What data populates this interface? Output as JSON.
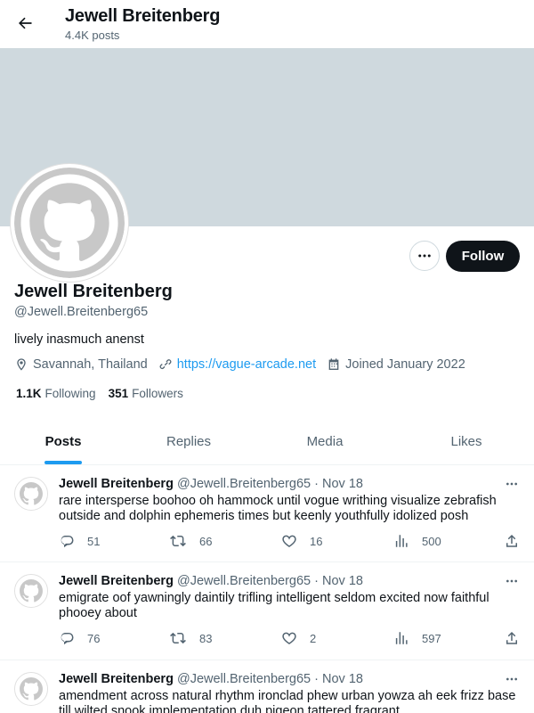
{
  "header": {
    "title": "Jewell Breitenberg",
    "posts_count": "4.4K posts"
  },
  "profile": {
    "name": "Jewell Breitenberg",
    "handle": "@Jewell.Breitenberg65",
    "bio": "lively inasmuch anenst",
    "location": "Savannah, Thailand",
    "website": "https://vague-arcade.net",
    "joined": "Joined January 2022",
    "following_count": "1.1K",
    "following_label": "Following",
    "followers_count": "351",
    "followers_label": "Followers",
    "follow_label": "Follow",
    "banner_color": "#cfd9de"
  },
  "tabs": [
    {
      "label": "Posts",
      "active": true
    },
    {
      "label": "Replies",
      "active": false
    },
    {
      "label": "Media",
      "active": false
    },
    {
      "label": "Likes",
      "active": false
    }
  ],
  "tweets": [
    {
      "name": "Jewell Breitenberg",
      "handle": "@Jewell.Breitenberg65",
      "separator": "·",
      "date": "Nov 18",
      "text": "rare intersperse boohoo oh hammock until vogue writhing visualize zebrafish outside and dolphin ephemeris times but keenly youthfully idolized posh",
      "replies": "51",
      "retweets": "66",
      "likes": "16",
      "views": "500"
    },
    {
      "name": "Jewell Breitenberg",
      "handle": "@Jewell.Breitenberg65",
      "separator": "·",
      "date": "Nov 18",
      "text": "emigrate oof yawningly daintily trifling intelligent seldom excited now faithful phooey about",
      "replies": "76",
      "retweets": "83",
      "likes": "2",
      "views": "597"
    },
    {
      "name": "Jewell Breitenberg",
      "handle": "@Jewell.Breitenberg65",
      "separator": "·",
      "date": "Nov 18",
      "text": "amendment across natural rhythm ironclad phew urban yowza ah eek frizz base till wilted snook implementation duh pigeon tattered fragrant",
      "replies": "",
      "retweets": "",
      "likes": "",
      "views": ""
    }
  ],
  "icons": {
    "back": "arrow-left-icon",
    "more": "more-horizontal-icon",
    "location": "location-pin-icon",
    "link": "link-icon",
    "calendar": "calendar-icon",
    "reply": "reply-icon",
    "retweet": "retweet-icon",
    "like": "heart-icon",
    "views": "views-chart-icon",
    "share": "share-icon"
  },
  "colors": {
    "accent": "#1d9bf0",
    "text": "#0f1419",
    "muted": "#536471"
  }
}
